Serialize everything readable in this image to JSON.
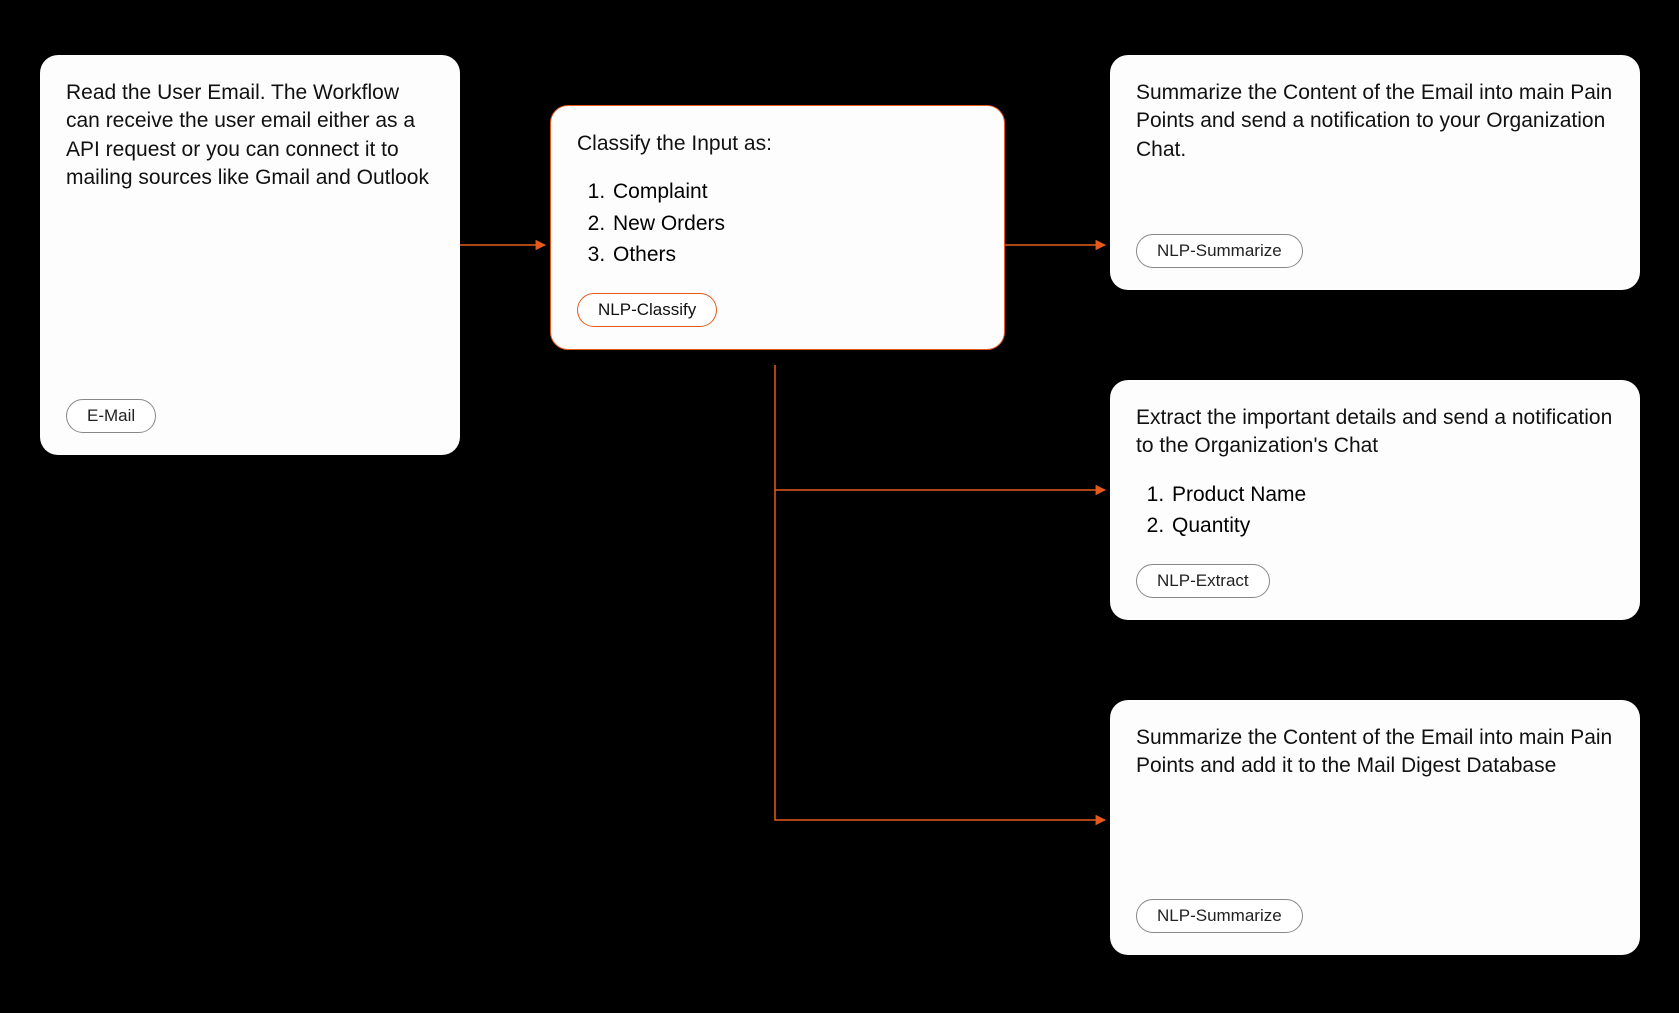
{
  "nodes": {
    "email": {
      "text": "Read the User Email. The Workflow can receive the user email either as a API request or you can connect it to mailing sources like Gmail and Outlook",
      "tag": "E-Mail"
    },
    "classify": {
      "heading": "Classify the Input as:",
      "items": [
        "Complaint",
        "New Orders",
        "Others"
      ],
      "tag": "NLP-Classify"
    },
    "summarize1": {
      "text": "Summarize the Content of the Email into main Pain Points and send a notification to your Organization Chat.",
      "tag": "NLP-Summarize"
    },
    "extract": {
      "text": "Extract the important details and send a notification to the Organization's Chat",
      "items": [
        "Product Name",
        "Quantity"
      ],
      "tag": "NLP-Extract"
    },
    "summarize2": {
      "text": "Summarize the Content of the Email into main Pain Points and add it to the Mail Digest Database",
      "tag": "NLP-Summarize"
    }
  },
  "colors": {
    "accent": "#e55a1b"
  }
}
